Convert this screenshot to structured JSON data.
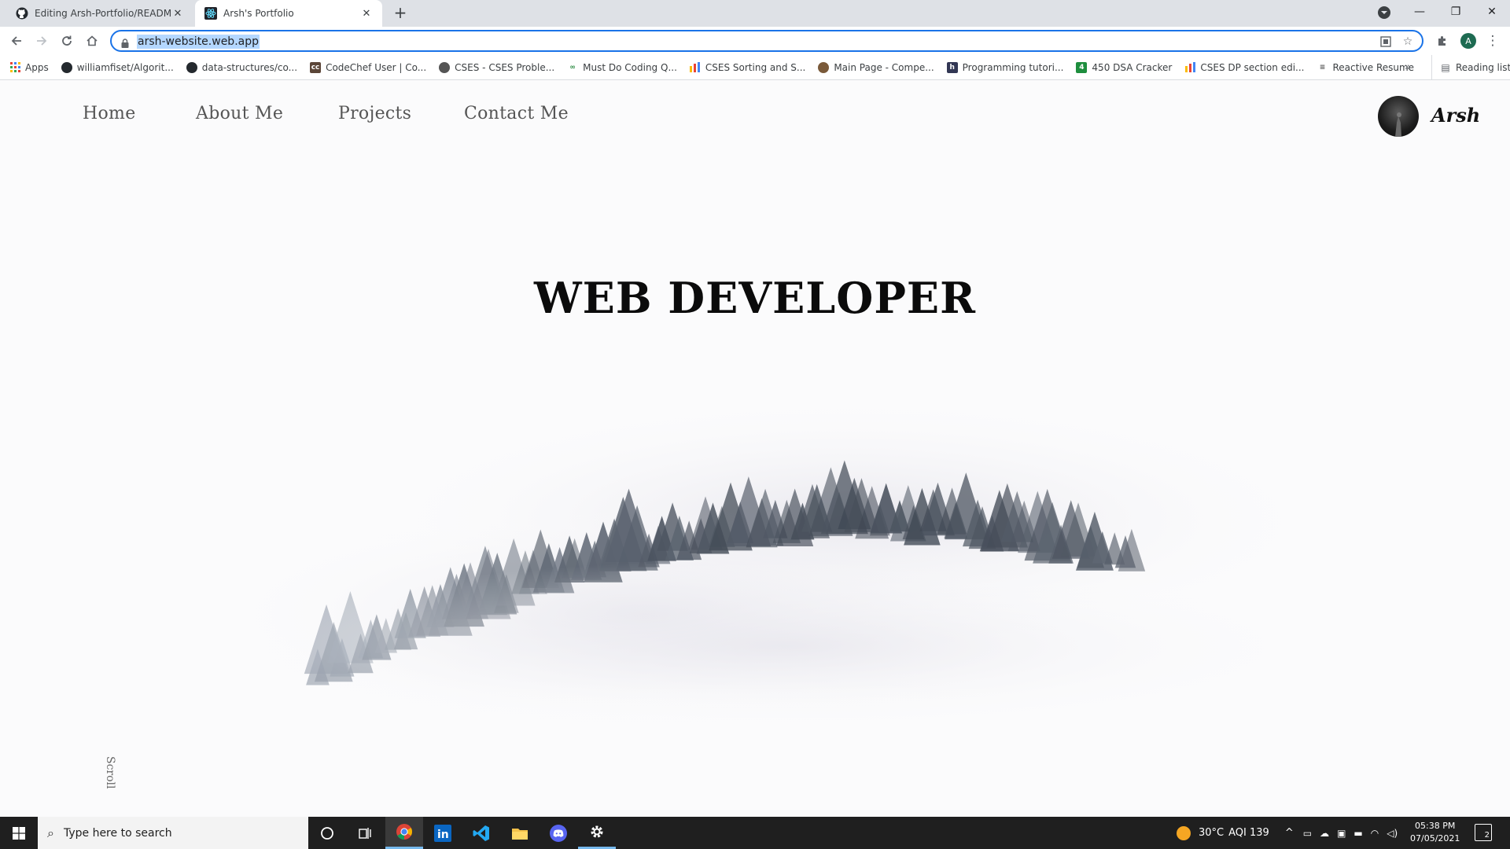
{
  "browser": {
    "tabs": [
      {
        "title": "Editing Arsh-Portfolio/README.m",
        "icon": "github-icon",
        "active": false
      },
      {
        "title": "Arsh's Portfolio",
        "icon": "react-icon",
        "active": true
      }
    ],
    "url": "arsh-website.web.app",
    "profile_initial": "A",
    "bookmarks": [
      {
        "label": "Apps",
        "icon": "apps-grid-icon"
      },
      {
        "label": "williamfiset/Algorit...",
        "icon": "github-icon"
      },
      {
        "label": "data-structures/co...",
        "icon": "github-icon"
      },
      {
        "label": "CodeChef User | Co...",
        "icon": "codechef-icon"
      },
      {
        "label": "CSES - CSES Proble...",
        "icon": "globe-icon"
      },
      {
        "label": "Must Do Coding Q...",
        "icon": "geeksforgeeks-icon"
      },
      {
        "label": "CSES Sorting and S...",
        "icon": "bar-chart-icon"
      },
      {
        "label": "Main Page - Compe...",
        "icon": "cp-algorithms-icon"
      },
      {
        "label": "Programming tutori...",
        "icon": "hackerearth-icon"
      },
      {
        "label": "450 DSA Cracker",
        "icon": "dsa-cracker-icon"
      },
      {
        "label": "CSES DP section edi...",
        "icon": "bar-chart-icon"
      },
      {
        "label": "Reactive Resume",
        "icon": "resume-icon"
      }
    ],
    "reading_list": "Reading list"
  },
  "site": {
    "nav": {
      "home": "Home",
      "about": "About Me",
      "projects": "Projects",
      "contact": "Contact Me"
    },
    "brand": "Arsh",
    "hero_title": "WEB DEVELOPER",
    "scroll_label": "Scroll"
  },
  "taskbar": {
    "search_placeholder": "Type here to search",
    "weather": "30°C",
    "aqi": "AQI 139",
    "time": "05:38 PM",
    "date": "07/05/2021",
    "notifications": "2"
  }
}
